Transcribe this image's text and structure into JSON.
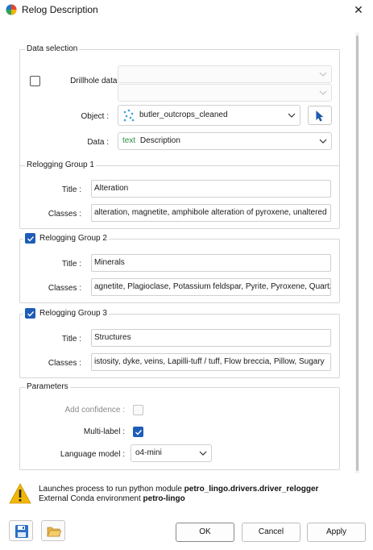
{
  "window": {
    "title": "Relog Description"
  },
  "data_selection": {
    "title": "Data selection",
    "drillhole_label": "Drillhole data :",
    "drillhole_checked": false,
    "object_label": "Object :",
    "object_value": "butler_outcrops_cleaned",
    "data_label": "Data :",
    "data_type_tag": "text",
    "data_value": "Description"
  },
  "group1": {
    "title": "Relogging Group 1",
    "title_label": "Title :",
    "title_value": "Alteration",
    "classes_label": "Classes :",
    "classes_value": "alteration, magnetite, amphibole alteration of pyroxene, unaltered"
  },
  "group2": {
    "title": "Relogging Group 2",
    "checked": true,
    "title_label": "Title :",
    "title_value": "Minerals",
    "classes_label": "Classes :",
    "classes_value": "agnetite, Plagioclase, Potassium feldspar, Pyrite, Pyroxene, Quartz"
  },
  "group3": {
    "title": "Relogging Group 3",
    "checked": true,
    "title_label": "Title :",
    "title_value": "Structures",
    "classes_label": "Classes :",
    "classes_value": "istosity, dyke, veins, Lapilli-tuff / tuff, Flow breccia, Pillow, Sugary"
  },
  "parameters": {
    "title": "Parameters",
    "add_confidence_label": "Add confidence :",
    "add_confidence_checked": false,
    "multi_label_label": "Multi-label :",
    "multi_label_checked": true,
    "language_model_label": "Language model :",
    "language_model_value": "o4-mini"
  },
  "footer": {
    "warning_line1_prefix": "Launches process to run python module ",
    "warning_module": "petro_lingo.drivers.driver_relogger",
    "warning_line2_prefix": "External Conda environment ",
    "warning_env": "petro-lingo",
    "ok_label": "OK",
    "cancel_label": "Cancel",
    "apply_label": "Apply"
  },
  "icons": {
    "app": "app-logo-icon",
    "close": "close-icon",
    "chevron": "chevron-down-icon",
    "points": "points-object-icon",
    "pick": "cursor-pick-icon",
    "warning": "warning-icon",
    "save": "save-icon",
    "open": "open-folder-icon"
  },
  "colors": {
    "accent": "#1e5db8",
    "text_tag": "#2e8b3e",
    "warning": "#f2b705"
  }
}
